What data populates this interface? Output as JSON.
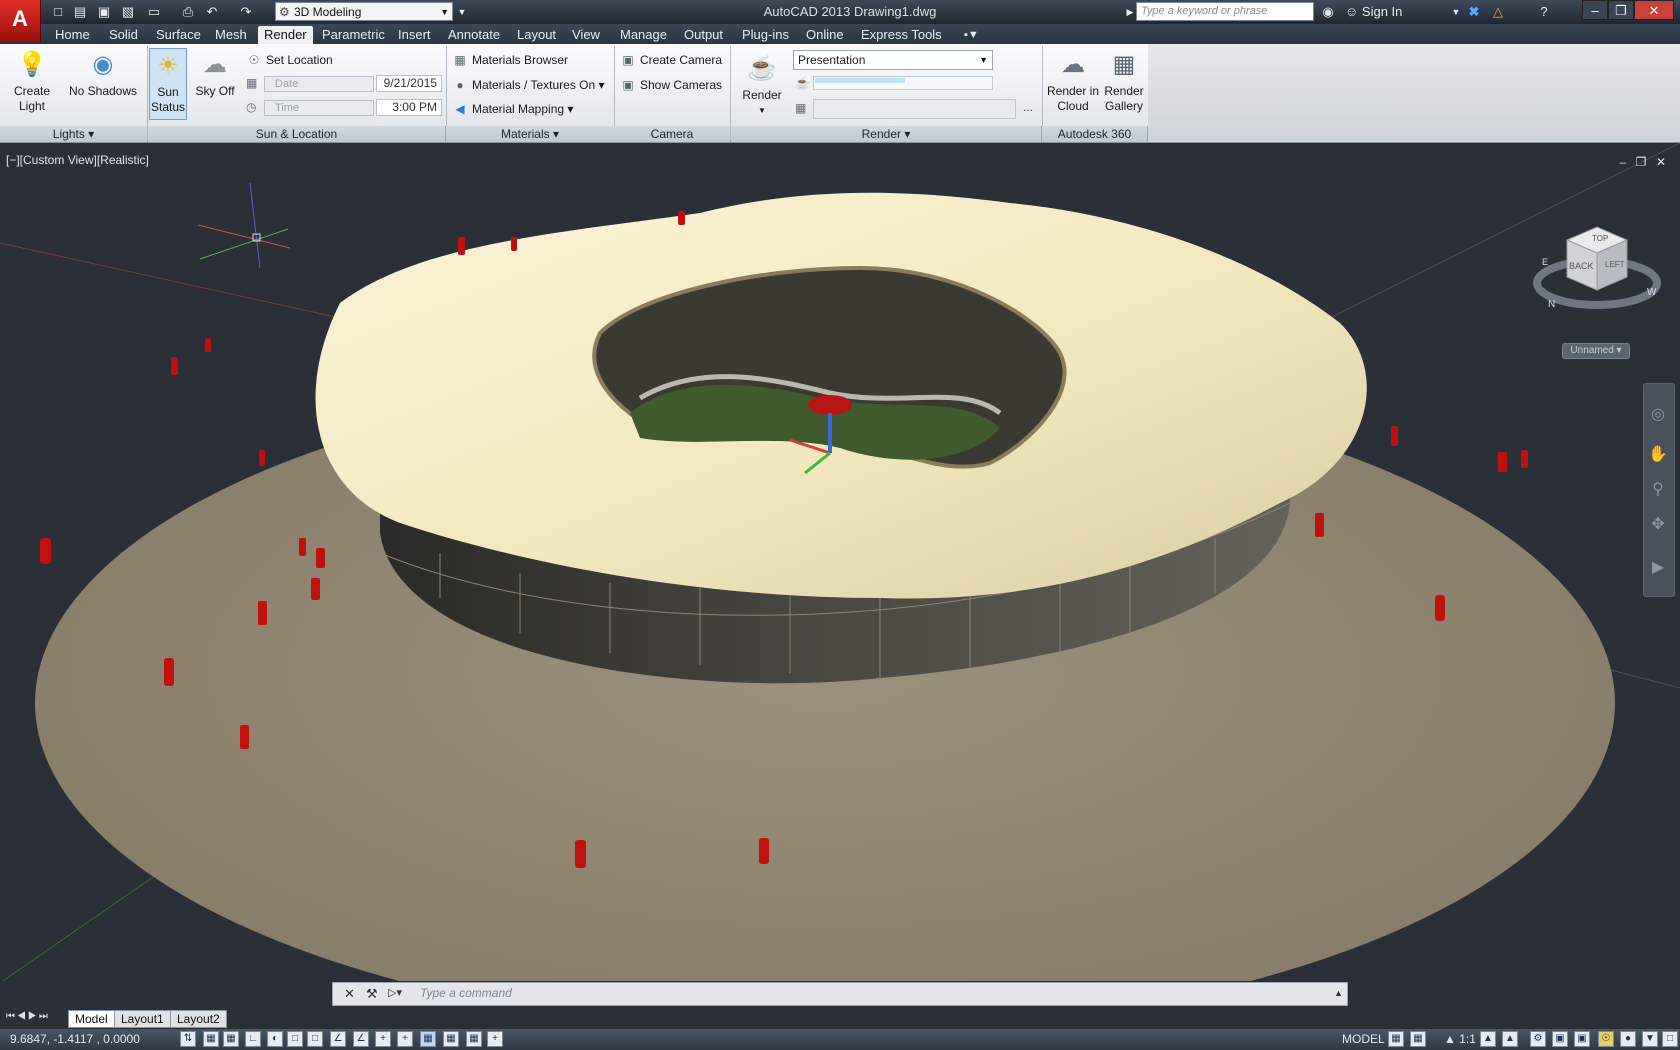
{
  "app": {
    "logo_letter": "A",
    "window_title": "AutoCAD 2013    Drawing1.dwg",
    "workspace": "3D Modeling",
    "search_placeholder": "Type a keyword or phrase",
    "sign_in": "Sign In"
  },
  "tabs": [
    "Home",
    "Solid",
    "Surface",
    "Mesh",
    "Render",
    "Parametric",
    "Insert",
    "Annotate",
    "Layout",
    "View",
    "Manage",
    "Output",
    "Plug-ins",
    "Online",
    "Express Tools"
  ],
  "active_tab": "Render",
  "ribbon": {
    "lights": {
      "title": "Lights",
      "create_light": [
        "Create",
        "Light"
      ],
      "no_shadows": "No Shadows"
    },
    "sun": {
      "title": "Sun & Location",
      "sun_status": [
        "Sun",
        "Status"
      ],
      "sky_off": "Sky Off",
      "set_location": "Set Location",
      "date_label": "Date",
      "date_value": "9/21/2015",
      "time_label": "Time",
      "time_value": "3:00 PM"
    },
    "materials": {
      "title": "Materials",
      "browser": "Materials Browser",
      "textures": "Materials / Textures On",
      "mapping": "Material Mapping"
    },
    "camera": {
      "title": "Camera",
      "create": "Create Camera",
      "show": "Show  Cameras"
    },
    "render": {
      "title": "Render",
      "render_btn": "Render",
      "preset": "Presentation",
      "more": "..."
    },
    "a360": {
      "title": "Autodesk 360",
      "cloud": [
        "Render in",
        "Cloud"
      ],
      "gallery": [
        "Render",
        "Gallery"
      ]
    }
  },
  "viewport": {
    "label": "[−][Custom View][Realistic]",
    "viewcube_top": "TOP",
    "viewcube_back": "BACK",
    "viewcube_left": "LEFT",
    "compass_n": "N",
    "compass_e": "E",
    "compass_w": "W",
    "named_view": "Unnamed"
  },
  "command": {
    "placeholder": "Type  a  command"
  },
  "layouts": [
    "Model",
    "Layout1",
    "Layout2"
  ],
  "status": {
    "coords": "9.6847,  -1.4117 , 0.0000",
    "model": "MODEL",
    "scale": "1:1"
  }
}
